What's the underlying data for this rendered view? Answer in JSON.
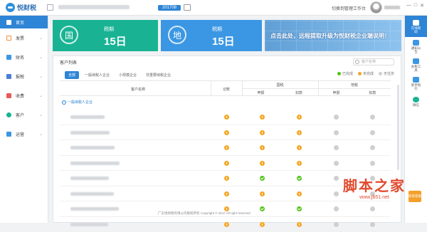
{
  "app": {
    "name": "悦财税"
  },
  "header": {
    "period": "201708",
    "workbench_link": "切换到管理工作台",
    "window_controls": [
      "—",
      "□",
      "✕"
    ]
  },
  "sidebar": {
    "items": [
      {
        "label": "首页",
        "icon": "home-icon",
        "active": true
      },
      {
        "label": "发票",
        "icon": "invoice-icon"
      },
      {
        "label": "财务",
        "icon": "finance-icon"
      },
      {
        "label": "报税",
        "icon": "tax-report-icon"
      },
      {
        "label": "收费",
        "icon": "fee-icon"
      },
      {
        "label": "客户",
        "icon": "customer-icon"
      },
      {
        "label": "运营",
        "icon": "operation-icon"
      }
    ]
  },
  "cards": {
    "national": {
      "icon_char": "国",
      "label": "税期",
      "value": "15日",
      "color": "#19b394"
    },
    "local": {
      "icon_char": "地",
      "label": "税期",
      "value": "15日",
      "color": "#3b97e3"
    },
    "ad": {
      "text": "点击此处，远程提取升级为悦财税企业端说明！"
    }
  },
  "customer_list": {
    "title": "客户列表",
    "search_placeholder": "客户名称",
    "tabs": [
      "全部",
      "一般纳税人企业",
      "小规模企业",
      "非重要纳税企业"
    ],
    "legend": [
      {
        "label": "已完成",
        "color": "#52c41a"
      },
      {
        "label": "未完成",
        "color": "#f5a623"
      },
      {
        "label": "无任务",
        "color": "#cfcfcf"
      }
    ],
    "columns": {
      "name": "客户名称",
      "bookkeeping": "记账",
      "national_tax": "国税",
      "local_tax": "地税",
      "declare": "申报",
      "deduct": "扣款"
    },
    "group_label": "一般纳税人企业",
    "rows": [
      [
        "warn",
        "warn",
        "warn",
        "gray",
        "gray"
      ],
      [
        "warn",
        "warn",
        "warn",
        "gray",
        "gray"
      ],
      [
        "warn",
        "warn",
        "warn",
        "gray",
        "gray"
      ],
      [
        "warn",
        "warn",
        "warn",
        "gray",
        "gray"
      ],
      [
        "warn",
        "ok",
        "ok",
        "gray",
        "gray"
      ],
      [
        "warn",
        "warn",
        "warn",
        "gray",
        "gray"
      ],
      [
        "warn",
        "ok",
        "ok",
        "gray",
        "gray"
      ],
      [
        "warn",
        "warn",
        "warn",
        "gray",
        "gray"
      ]
    ]
  },
  "footer": {
    "text": "广东悦财税有限公司版权所有  Copyright © 2017 All right reserved"
  },
  "rightbar": {
    "items": [
      {
        "label": "在线帮助",
        "icon": "help-icon",
        "active": true
      },
      {
        "label": "通知公告",
        "icon": "notice-icon"
      },
      {
        "label": "办税工具",
        "icon": "tools-icon"
      },
      {
        "label": "新手指引",
        "icon": "guide-icon"
      },
      {
        "label": "微信",
        "icon": "wechat-icon"
      }
    ]
  },
  "float_button": "联系客服",
  "watermark": {
    "title": "脚本之家",
    "url": "www.jb51.net"
  }
}
